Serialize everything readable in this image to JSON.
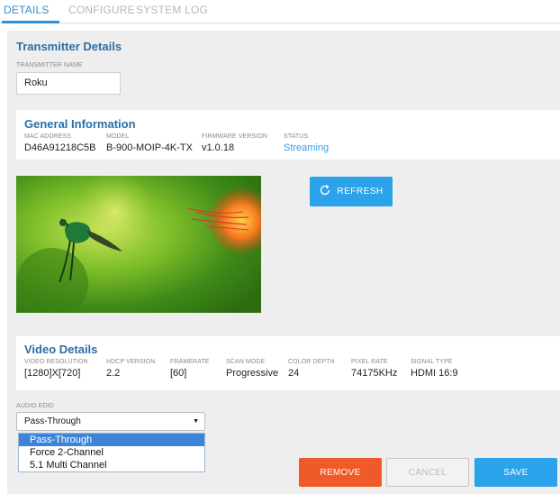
{
  "tabs": [
    {
      "label": "DETAILS",
      "active": true
    },
    {
      "label": "CONFIGURE",
      "active": false
    },
    {
      "label": "SYSTEM LOG",
      "active": false
    }
  ],
  "transmitter": {
    "section_title": "Transmitter Details",
    "name_label": "TRANSMITTER NAME",
    "name_value": "Roku"
  },
  "general": {
    "title": "General Information",
    "fields": [
      {
        "label": "MAC ADDRESS",
        "value": "D46A91218C5B"
      },
      {
        "label": "MODEL",
        "value": "B-900-MOIP-4K-TX"
      },
      {
        "label": "FIRMWARE VERSION",
        "value": "v1.0.18"
      },
      {
        "label": "STATUS",
        "value": "Streaming"
      }
    ]
  },
  "preview": {
    "refresh_label": "REFRESH",
    "refresh_icon": "refresh-icon"
  },
  "video": {
    "title": "Video Details",
    "fields": [
      {
        "label": "VIDEO RESOLUTION",
        "value": "[1280]X[720]"
      },
      {
        "label": "HDCP VERSION",
        "value": "2.2"
      },
      {
        "label": "FRAMERATE",
        "value": "[60]"
      },
      {
        "label": "SCAN MODE",
        "value": "Progressive"
      },
      {
        "label": "COLOR DEPTH",
        "value": "24"
      },
      {
        "label": "PIXEL RATE",
        "value": "74175KHz"
      },
      {
        "label": "SIGNAL TYPE",
        "value": "HDMI 16:9"
      }
    ]
  },
  "audio": {
    "label": "AUDIO EDID",
    "selected": "Pass-Through",
    "options": [
      "Pass-Through",
      "Force 2-Channel",
      "5.1 Multi Channel"
    ]
  },
  "actions": {
    "remove": "REMOVE",
    "cancel": "CANCEL",
    "save": "SAVE"
  },
  "colors": {
    "accent": "#2ba3ea",
    "tab_active": "#2d8fd5",
    "status": "#2ba3ea",
    "remove": "#f05a28",
    "section_title": "#2a6ea8"
  }
}
